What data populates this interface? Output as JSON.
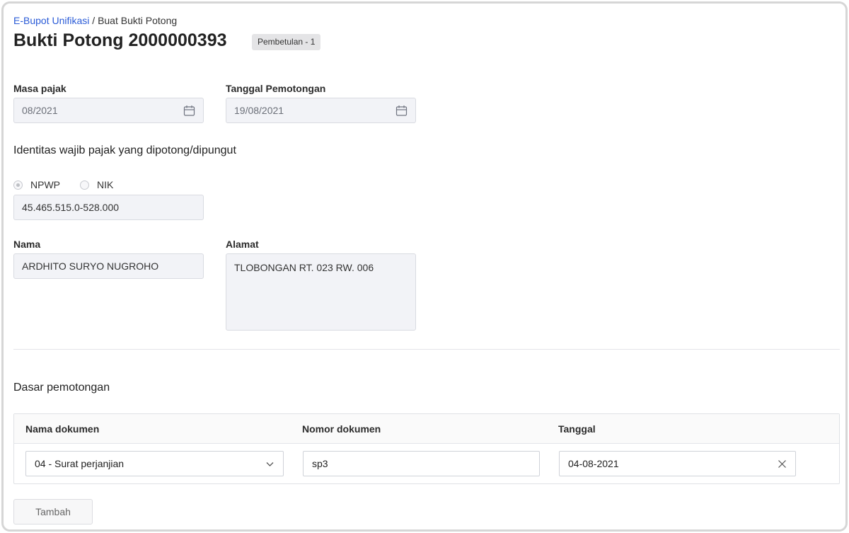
{
  "breadcrumb": {
    "link": "E-Bupot Unifikasi",
    "separator": "/",
    "current": "Buat Bukti Potong"
  },
  "page": {
    "title": "Bukti Potong 2000000393",
    "badge": "Pembetulan - 1"
  },
  "masa_pajak": {
    "label": "Masa pajak",
    "value": "08/2021",
    "icon": "calendar-icon"
  },
  "tanggal_pemotongan": {
    "label": "Tanggal Pemotongan",
    "value": "19/08/2021",
    "icon": "calendar-icon"
  },
  "identitas": {
    "heading": "Identitas wajib pajak yang dipotong/dipungut",
    "options": [
      "NPWP",
      "NIK"
    ],
    "selected": "NPWP",
    "npwp_value": "45.465.515.0-528.000"
  },
  "nama": {
    "label": "Nama",
    "value": "ARDHITO SURYO NUGROHO"
  },
  "alamat": {
    "label": "Alamat",
    "value": "TLOBONGAN RT. 023 RW. 006"
  },
  "dasar": {
    "heading": "Dasar pemotongan",
    "columns": [
      "Nama dokumen",
      "Nomor dokumen",
      "Tanggal"
    ],
    "row": {
      "nama_dokumen": "04 - Surat perjanjian",
      "nomor_dokumen": "sp3",
      "tanggal": "04-08-2021"
    },
    "add_label": "Tambah"
  },
  "colors": {
    "link": "#2a5bd7",
    "field_bg": "#f2f3f7",
    "border": "#d9dbe1"
  }
}
